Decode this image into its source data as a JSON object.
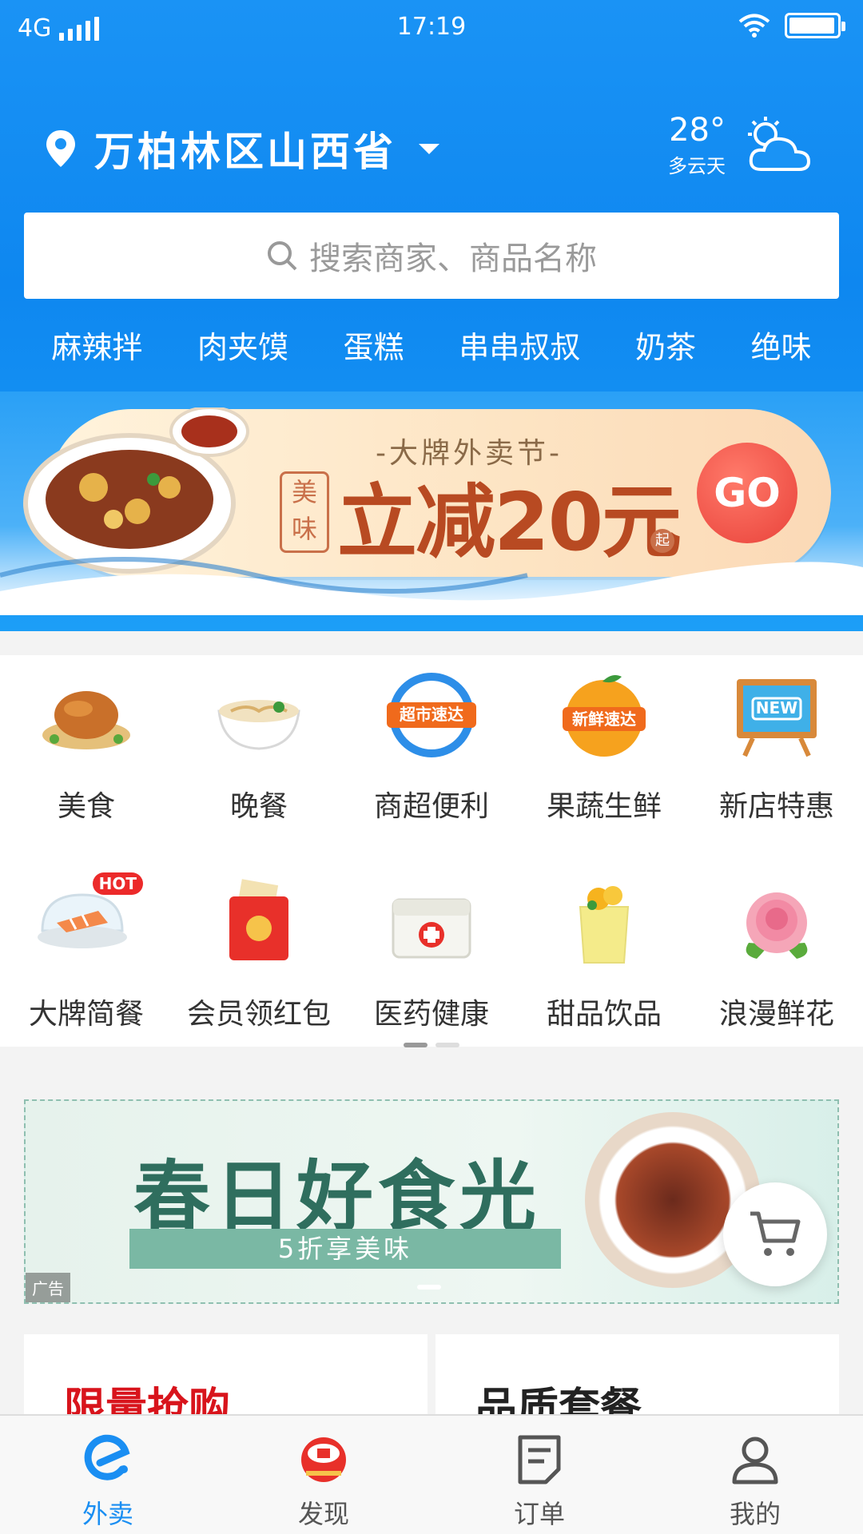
{
  "status_bar": {
    "network": "4G",
    "time": "17:19"
  },
  "location": {
    "text": "万柏林区山西省"
  },
  "weather": {
    "temp": "28°",
    "desc": "多云天"
  },
  "search": {
    "placeholder": "搜索商家、商品名称"
  },
  "hot_words": [
    "麻辣拌",
    "肉夹馍",
    "蛋糕",
    "串串叔叔",
    "奶茶",
    "绝味"
  ],
  "promo": {
    "subtitle": "-大牌外卖节-",
    "seal": "美味",
    "headline": "立减20元",
    "qi": "起",
    "go": "GO"
  },
  "categories": [
    {
      "label": "美食",
      "icon": "roast-chicken-icon"
    },
    {
      "label": "晚餐",
      "icon": "noodle-bowl-icon"
    },
    {
      "label": "商超便利",
      "icon": "supermarket-express-icon",
      "badge": "超市速达"
    },
    {
      "label": "果蔬生鲜",
      "icon": "fresh-orange-icon",
      "badge": "新鲜速达"
    },
    {
      "label": "新店特惠",
      "icon": "new-sign-icon",
      "badge": "NEW"
    },
    {
      "label": "大牌简餐",
      "icon": "salmon-dish-icon",
      "badge": "HOT"
    },
    {
      "label": "会员领红包",
      "icon": "red-packet-icon"
    },
    {
      "label": "医药健康",
      "icon": "medical-kit-icon"
    },
    {
      "label": "甜品饮品",
      "icon": "dessert-drink-icon"
    },
    {
      "label": "浪漫鲜花",
      "icon": "rose-icon"
    }
  ],
  "ad": {
    "title": "春日好食光",
    "subtitle": "5折享美味",
    "tag": "广告"
  },
  "cards": [
    {
      "title": "限量抢购"
    },
    {
      "title": "品质套餐"
    }
  ],
  "tabs": [
    {
      "label": "外卖",
      "icon": "waimai-icon",
      "active": true
    },
    {
      "label": "发现",
      "icon": "discover-drum-icon",
      "active": false
    },
    {
      "label": "订单",
      "icon": "order-list-icon",
      "active": false
    },
    {
      "label": "我的",
      "icon": "user-profile-icon",
      "active": false
    }
  ],
  "colors": {
    "primary": "#1a8ef2",
    "promo_red": "#e9423a",
    "flash_red": "#d8141c"
  }
}
